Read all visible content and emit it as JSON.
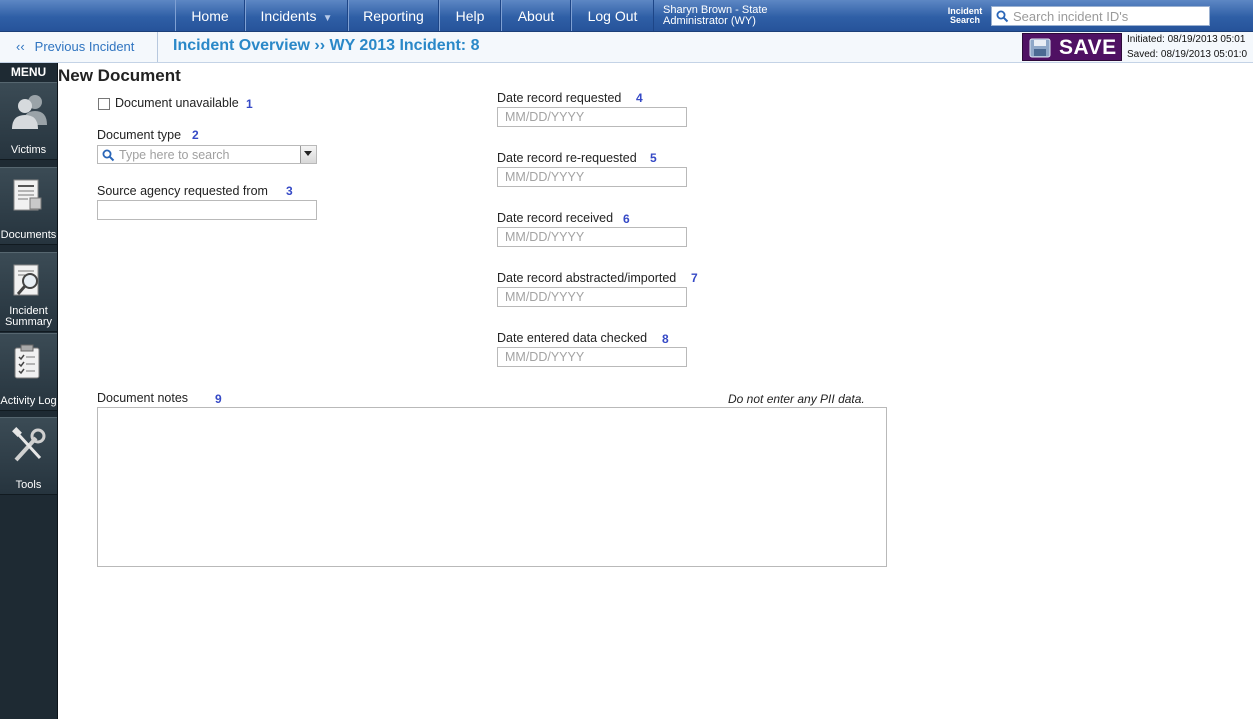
{
  "nav": {
    "items": [
      {
        "label": "Home"
      },
      {
        "label": "Incidents",
        "has_dropdown": true
      },
      {
        "label": "Reporting"
      },
      {
        "label": "Help"
      },
      {
        "label": "About"
      },
      {
        "label": "Log Out"
      }
    ],
    "user": {
      "line1": "Sharyn Brown - State",
      "line2": "Administrator (WY)"
    },
    "search": {
      "label_line1": "Incident",
      "label_line2": "Search",
      "placeholder": "Search incident ID's"
    }
  },
  "subbar": {
    "prev_chevron": "‹‹",
    "prev_label": "Previous Incident",
    "breadcrumb": "Incident Overview ›› WY 2013 Incident: 8",
    "save_label": "SAVE",
    "initiated": "Initiated: 08/19/2013 05:01",
    "saved": "Saved: 08/19/2013 05:01:0"
  },
  "sidebar": {
    "menu_label": "MENU",
    "items": [
      {
        "label": "Victims",
        "icon": "victims-icon"
      },
      {
        "label": "Documents",
        "icon": "documents-icon"
      },
      {
        "label_line1": "Incident",
        "label_line2": "Summary",
        "icon": "incident-summary-icon"
      },
      {
        "label": "Activity Log",
        "icon": "activity-log-icon"
      },
      {
        "label": "Tools",
        "icon": "tools-icon"
      }
    ]
  },
  "form": {
    "title": "New Document",
    "doc_unavailable": {
      "label": "Document unavailable",
      "num": "1",
      "checked": false
    },
    "doc_type": {
      "label": "Document type",
      "num": "2",
      "placeholder": "Type here to search"
    },
    "source_agency": {
      "label": "Source agency requested from",
      "num": "3",
      "value": ""
    },
    "dates": [
      {
        "label": "Date record requested",
        "num": "4",
        "placeholder": "MM/DD/YYYY"
      },
      {
        "label": "Date record re-requested",
        "num": "5",
        "placeholder": "MM/DD/YYYY"
      },
      {
        "label": "Date record received",
        "num": "6",
        "placeholder": "MM/DD/YYYY"
      },
      {
        "label": "Date record abstracted/imported",
        "num": "7",
        "placeholder": "MM/DD/YYYY"
      },
      {
        "label": "Date entered data checked",
        "num": "8",
        "placeholder": "MM/DD/YYYY"
      }
    ],
    "notes": {
      "label": "Document notes",
      "num": "9",
      "pii_note": "Do not enter any PII data.",
      "value": ""
    }
  },
  "colors": {
    "nav_blue": "#2f5fa6",
    "link_blue": "#2a88c8",
    "save_purple": "#4f1163",
    "sidebar_dark": "#1e2a33",
    "number_blue": "#3549c6"
  }
}
